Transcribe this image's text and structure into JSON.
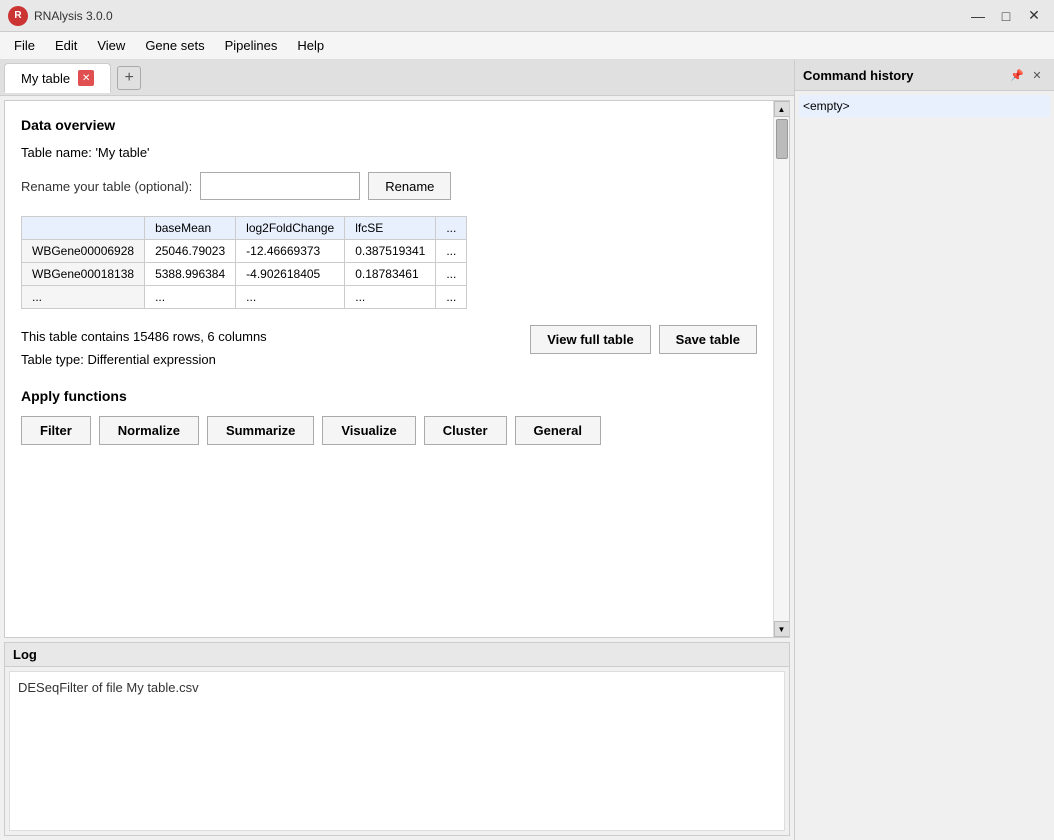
{
  "app": {
    "title": "RNAlysis 3.0.0",
    "logo": "R"
  },
  "titlebar": {
    "minimize": "—",
    "maximize": "□",
    "close": "✕"
  },
  "menu": {
    "items": [
      "File",
      "Edit",
      "View",
      "Gene sets",
      "Pipelines",
      "Help"
    ]
  },
  "tab": {
    "title": "My table",
    "close_icon": "✕",
    "add_icon": "+"
  },
  "command_history": {
    "title": "Command history",
    "content": "<empty>",
    "pin_icon": "📌",
    "close_icon": "✕"
  },
  "data_overview": {
    "section_title": "Data overview",
    "table_name_label": "Table name: ",
    "table_name_value": "'My table'",
    "rename_label": "Rename your table (optional):",
    "rename_placeholder": "",
    "rename_btn": "Rename",
    "table": {
      "headers": [
        "",
        "baseMean",
        "log2FoldChange",
        "lfcSE",
        "..."
      ],
      "rows": [
        [
          "WBGene00006928",
          "25046.79023",
          "-12.46669373",
          "0.387519341",
          "..."
        ],
        [
          "WBGene00018138",
          "5388.996384",
          "-4.902618405",
          "0.18783461",
          "..."
        ],
        [
          "...",
          "...",
          "...",
          "...",
          "..."
        ]
      ]
    },
    "table_info_line1": "This table contains 15486 rows, 6 columns",
    "table_info_line2": "Table type: Differential expression",
    "view_full_table_btn": "View full table",
    "save_table_btn": "Save table"
  },
  "apply_functions": {
    "title": "Apply functions",
    "buttons": [
      "Filter",
      "Normalize",
      "Summarize",
      "Visualize",
      "Cluster",
      "General"
    ]
  },
  "log": {
    "title": "Log",
    "content": "DESeqFilter of file My table.csv"
  }
}
